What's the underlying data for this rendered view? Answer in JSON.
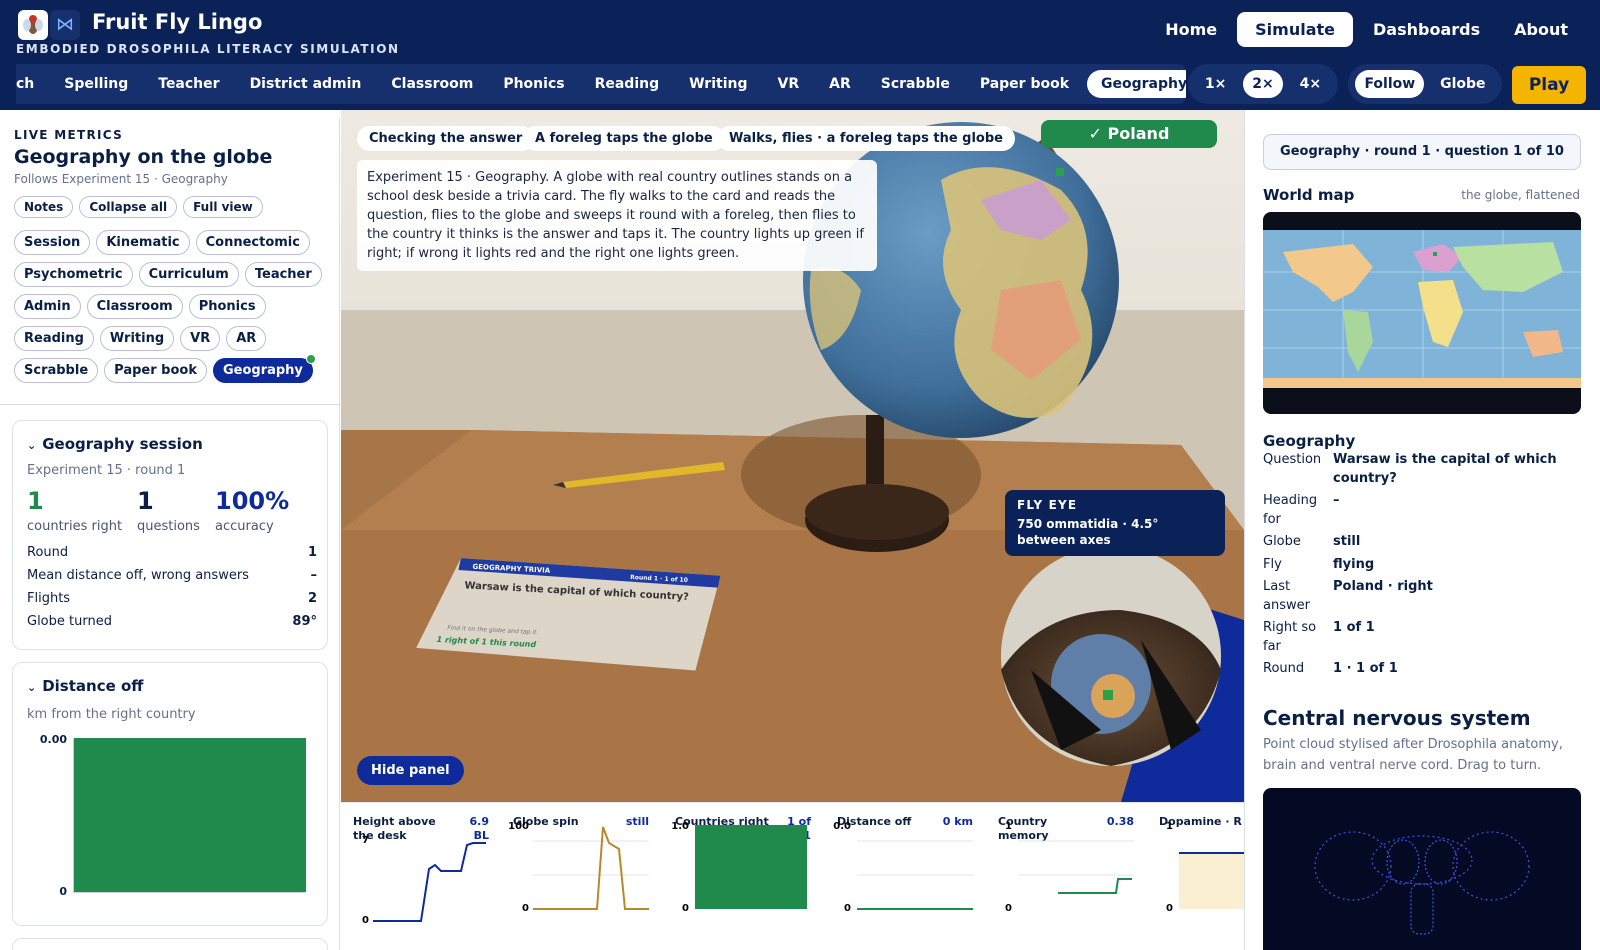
{
  "app": {
    "title": "Fruit Fly Lingo",
    "subtitle": "EMBODIED DROSOPHILA LITERACY SIMULATION",
    "nav": [
      "Home",
      "Simulate",
      "Dashboards",
      "About"
    ],
    "nav_active": "Simulate"
  },
  "modes": {
    "items": [
      "ch",
      "Spelling",
      "Teacher",
      "District admin",
      "Classroom",
      "Phonics",
      "Reading",
      "Writing",
      "VR",
      "AR",
      "Scrabble",
      "Paper book",
      "Geography"
    ],
    "active": "Geography"
  },
  "speed": {
    "items": [
      "1×",
      "2×",
      "4×"
    ],
    "active": "2×"
  },
  "camera": {
    "items": [
      "Follow",
      "Globe"
    ],
    "active": "Follow"
  },
  "play_label": "Play",
  "left": {
    "section_label": "LIVE METRICS",
    "title": "Geography on the globe",
    "subtitle": "Follows Experiment 15 · Geography",
    "view_buttons": [
      "Notes",
      "Collapse all",
      "Full view"
    ],
    "metric_tabs": [
      "Session",
      "Kinematic",
      "Connectomic",
      "Psychometric",
      "Curriculum",
      "Teacher",
      "Admin",
      "Classroom",
      "Phonics",
      "Reading",
      "Writing",
      "VR",
      "AR",
      "Scrabble",
      "Paper book",
      "Geography"
    ],
    "active_tab": "Geography",
    "session_card": {
      "title": "Geography session",
      "subtitle": "Experiment 15 · round 1",
      "stats": [
        {
          "value": "1",
          "label": "countries right",
          "color": "#1f8a4c"
        },
        {
          "value": "1",
          "label": "questions",
          "color": "#0a1f44"
        },
        {
          "value": "100%",
          "label": "accuracy",
          "color": "#0f2a9a"
        }
      ],
      "rows": [
        {
          "k": "Round",
          "v": "1"
        },
        {
          "k": "Mean distance off, wrong answers",
          "v": "–"
        },
        {
          "k": "Flights",
          "v": "2"
        },
        {
          "k": "Globe turned",
          "v": "89°"
        }
      ]
    },
    "distance_card": {
      "title": "Distance off",
      "subtitle": "km from the right country",
      "ymax_label": "0.00",
      "ymin_label": "0",
      "fill_fraction": 1.0
    }
  },
  "scene": {
    "tags": [
      "Checking the answer",
      "A foreleg taps the globe",
      "Walks, flies · a foreleg taps the globe"
    ],
    "description": "Experiment 15 · Geography. A globe with real country outlines stands on a school desk beside a trivia card. The fly walks to the card and reads the question, flies to the globe and sweeps it round with a foreleg, then flies to the country it thinks is the answer and taps it. The country lights up green if right; if wrong it lights red and the right one lights green.",
    "result_badge": "✓ Poland",
    "trivia_card": {
      "header": "GEOGRAPHY TRIVIA",
      "round": "Round 1 · 1 of 10",
      "question": "Warsaw is the capital of which country?",
      "hint": "Find it on the globe and tap it.",
      "score": "1 right of 1 this round"
    },
    "fly_eye": {
      "title": "FLY EYE",
      "desc": "750 ommatidia · 4.5° between axes"
    },
    "hide_panel": "Hide panel"
  },
  "strip": [
    {
      "title": "Height above the desk",
      "value": "6.9 BL",
      "ymax": "7",
      "ymin": "0",
      "color": "#0f2a9a"
    },
    {
      "title": "Globe spin",
      "value": "still",
      "ymax": "100",
      "ymin": "0",
      "color": "#b8892a"
    },
    {
      "title": "Countries right",
      "value": "1 of 1",
      "ymax": "1.0",
      "ymin": "0",
      "color": "#1f8a4c"
    },
    {
      "title": "Distance off",
      "value": "0 km",
      "ymax": "0.0",
      "ymin": "0",
      "color": "#1f8a4c"
    },
    {
      "title": "Country memory",
      "value": "0.38",
      "ymax": "1",
      "ymin": "0",
      "color": "#1f8a4c"
    },
    {
      "title": "Dopamine · R",
      "value": "",
      "ymax": "1",
      "ymin": "0",
      "color": "#0f2a9a"
    }
  ],
  "right": {
    "round_info": "Geography · round 1 · question 1 of 10",
    "map_title": "World map",
    "map_hint": "the globe, flattened",
    "geo_title": "Geography",
    "facts": [
      {
        "k": "Question",
        "v": "Warsaw is the capital of which country?"
      },
      {
        "k": "Heading for",
        "v": "–"
      },
      {
        "k": "Globe",
        "v": "still"
      },
      {
        "k": "Fly",
        "v": "flying"
      },
      {
        "k": "Last answer",
        "v": "Poland · right"
      },
      {
        "k": "Right so far",
        "v": "1 of 1"
      },
      {
        "k": "Round",
        "v": "1 · 1 of 1"
      }
    ],
    "cns_title": "Central nervous system",
    "cns_desc": "Point cloud stylised after Drosophila anatomy, brain and ventral nerve cord. Drag to turn."
  }
}
